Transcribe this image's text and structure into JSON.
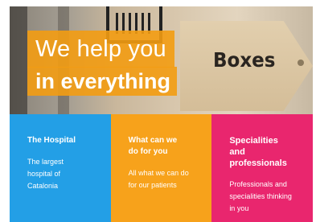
{
  "hero": {
    "line1": "We help you",
    "line2": "in everything",
    "sign_text": "Boxes"
  },
  "cards": [
    {
      "title": "The Hospital",
      "text": "The largest hospital of Catalonia",
      "color": "#239fe6"
    },
    {
      "title": "What can we do for you",
      "text": "All what we can do for our patients",
      "color": "#f7a21b"
    },
    {
      "title": "Specialities and professionals",
      "text": "Professionals and specialities thinking in you",
      "color": "#e9266e"
    }
  ],
  "colors": {
    "accent": "#f39c12"
  }
}
